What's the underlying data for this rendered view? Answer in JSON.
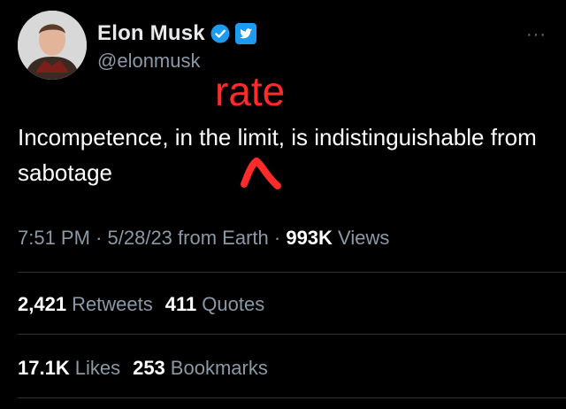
{
  "author": {
    "name": "Elon Musk",
    "handle": "@elonmusk"
  },
  "annotation": "rate",
  "tweet": {
    "text": "Incompetence, in the limit, is indistinguishable from sabotage"
  },
  "meta": {
    "time": "7:51 PM",
    "sep1": "·",
    "date": "5/28/23",
    "source": "from Earth",
    "sep2": "·",
    "views_count": "993K",
    "views_label": "Views"
  },
  "stats": {
    "retweets_count": "2,421",
    "retweets_label": "Retweets",
    "quotes_count": "411",
    "quotes_label": "Quotes",
    "likes_count": "17.1K",
    "likes_label": "Likes",
    "bookmarks_count": "253",
    "bookmarks_label": "Bookmarks"
  },
  "more_icon": "···",
  "icons": {
    "verified": "verified-badge-icon",
    "twitter": "twitter-logo-icon",
    "more": "more-options-icon"
  },
  "colors": {
    "background": "#000000",
    "text": "#ffffff",
    "muted": "#8b98a5",
    "accent": "#1d9bf0",
    "annotation": "#ff2a2a"
  }
}
